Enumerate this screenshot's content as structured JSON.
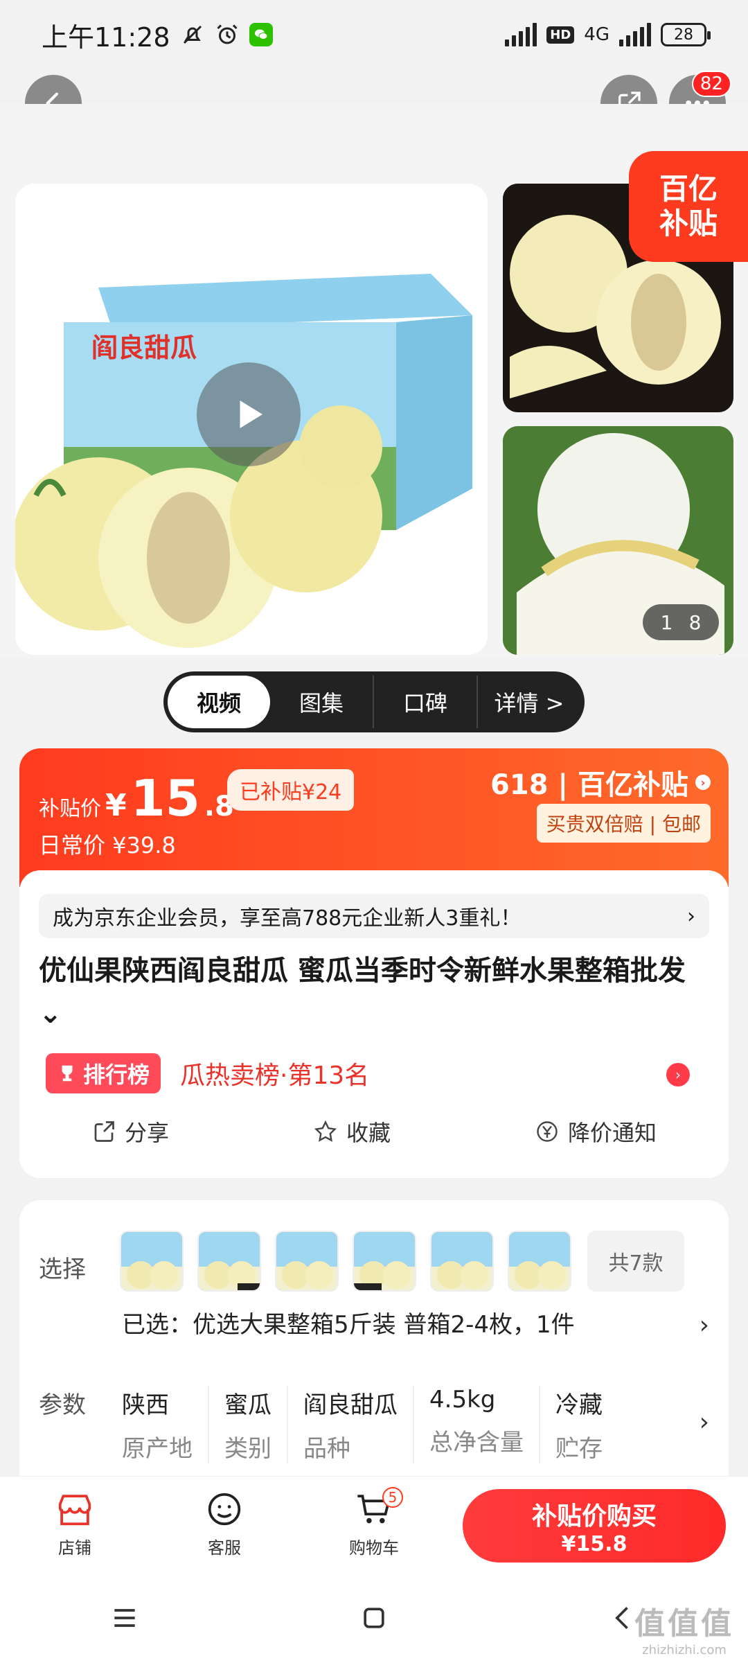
{
  "status_bar": {
    "time": "上午11:28",
    "network": "4G",
    "hd": "HD",
    "battery": "28"
  },
  "nav": {
    "more_badge": "82"
  },
  "gallery": {
    "subsidy_tag_line1": "百亿",
    "subsidy_tag_line2": "补贴",
    "box_text": "阎良甜瓜",
    "image_index": "1",
    "image_total": "8"
  },
  "media_tabs": [
    {
      "label": "视频"
    },
    {
      "label": "图集"
    },
    {
      "label": "口碑"
    },
    {
      "label": "详情 >"
    }
  ],
  "price": {
    "label": "补贴价",
    "currency": "¥",
    "integer": "15",
    "decimal": ".8",
    "subsidized": "已补贴¥24",
    "regular": "日常价 ¥39.8",
    "brand": "618 | 百亿补贴",
    "guarantee": "买贵双倍赔 | 包邮"
  },
  "promo": {
    "text": "成为京东企业会员，享至高788元企业新人3重礼！",
    "arrow": "›"
  },
  "product": {
    "title": "优仙果陕西阎良甜瓜 蜜瓜当季时令新鲜水果整箱批发 ⌄"
  },
  "rank": {
    "badge": "排行榜",
    "text": "瓜热卖榜·第13名"
  },
  "actions": [
    {
      "label": "分享",
      "icon": "share-icon"
    },
    {
      "label": "收藏",
      "icon": "star-icon"
    },
    {
      "label": "降价通知",
      "icon": "price-drop-icon"
    }
  ],
  "options": {
    "select_label": "选择",
    "more_count": "共7款",
    "selected_text": "已选：优选大果整箱5斤装 普箱2-4枚，1件",
    "params_label": "参数",
    "params": [
      {
        "value": "陕西",
        "key": "原产地"
      },
      {
        "value": "蜜瓜",
        "key": "类别"
      },
      {
        "value": "阎良甜瓜",
        "key": "品种"
      },
      {
        "value": "4.5kg",
        "key": "总净含量"
      },
      {
        "value": "冷藏",
        "key": "贮存"
      }
    ]
  },
  "bottom_bar": {
    "store": "店铺",
    "service": "客服",
    "cart": "购物车",
    "cart_count": "5",
    "buy_main": "补贴价购买",
    "buy_price": "¥15.8"
  },
  "watermark": {
    "big": "值值值",
    "small": "zhizhizhi.com"
  }
}
